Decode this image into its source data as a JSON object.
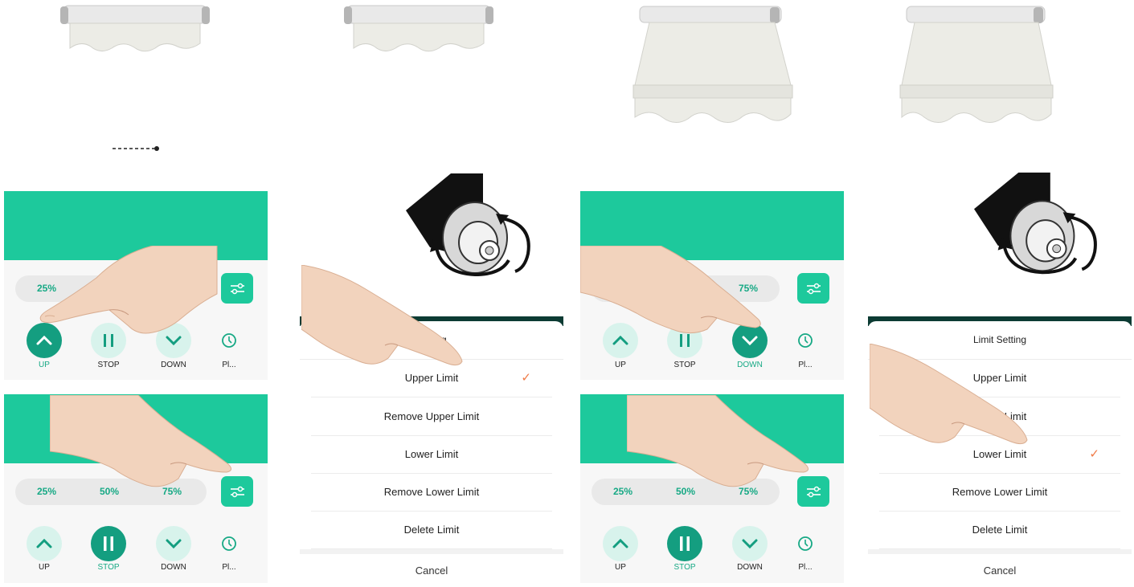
{
  "motor_scenes": [
    {
      "positions": [
        "25%",
        "",
        ""
      ],
      "controls": [
        "UP",
        "STOP",
        "DOWN",
        "Pl..."
      ],
      "active": "UP"
    },
    {
      "positions": [
        "25%",
        "50%",
        "75%"
      ],
      "controls": [
        "UP",
        "STOP",
        "DOWN",
        "Pl..."
      ],
      "active": "STOP"
    },
    {
      "positions": [
        "",
        "",
        "75%"
      ],
      "controls": [
        "UP",
        "STOP",
        "DOWN",
        "Pl..."
      ],
      "active": "DOWN"
    },
    {
      "positions": [
        "25%",
        "50%",
        "75%"
      ],
      "controls": [
        "UP",
        "STOP",
        "DOWN",
        "Pl..."
      ],
      "active": "STOP"
    }
  ],
  "limit_sheet_a": {
    "title": "Setting",
    "options": [
      "Upper Limit",
      "Remove Upper Limit",
      "Lower Limit",
      "Remove Lower Limit",
      "Delete Limit"
    ],
    "selected": "Upper Limit",
    "cancel": "Cancel"
  },
  "limit_sheet_b": {
    "title": "Limit Setting",
    "options": [
      "Upper Limit",
      "Upper Limit",
      "Lower Limit",
      "Remove Lower Limit",
      "Delete Limit"
    ],
    "selected": "Lower Limit",
    "cancel": "Cancel"
  },
  "icons": {
    "up": "chevron-up-icon",
    "stop": "pause-icon",
    "down": "chevron-down-icon",
    "plan": "timer-icon",
    "settings": "sliders-icon",
    "check": "check-icon"
  },
  "colors": {
    "brand": "#1dc99c",
    "brand_dark": "#149e80",
    "check": "#f07a46"
  }
}
